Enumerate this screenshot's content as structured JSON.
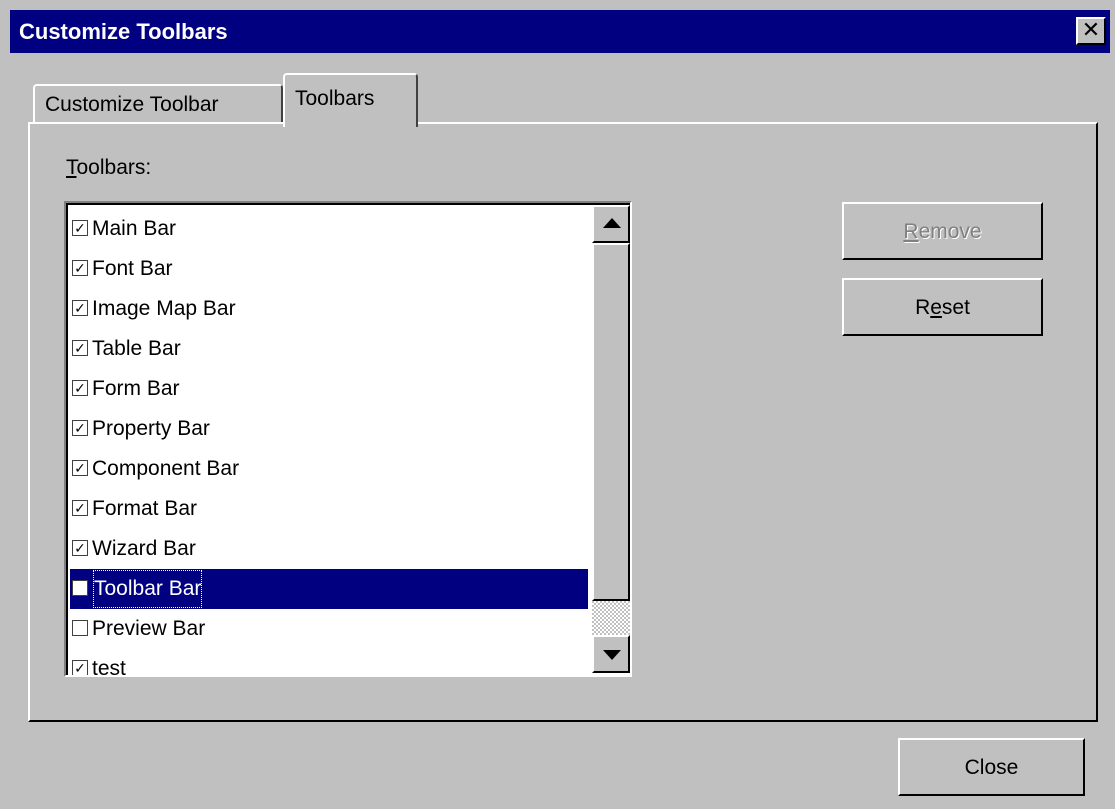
{
  "window": {
    "title": "Customize Toolbars",
    "close_glyph": "✕"
  },
  "tabs": [
    {
      "label": "Customize Toolbar",
      "active": false
    },
    {
      "label": "Toolbars",
      "active": true
    }
  ],
  "toolbars_label": {
    "accel": "T",
    "rest": "oolbars:"
  },
  "list": {
    "items": [
      {
        "label": "Main Bar",
        "checked": true,
        "selected": false
      },
      {
        "label": "Font Bar",
        "checked": true,
        "selected": false
      },
      {
        "label": "Image Map Bar",
        "checked": true,
        "selected": false
      },
      {
        "label": "Table Bar",
        "checked": true,
        "selected": false
      },
      {
        "label": "Form Bar",
        "checked": true,
        "selected": false
      },
      {
        "label": "Property Bar",
        "checked": true,
        "selected": false
      },
      {
        "label": "Component Bar",
        "checked": true,
        "selected": false
      },
      {
        "label": "Format Bar",
        "checked": true,
        "selected": false
      },
      {
        "label": "Wizard Bar",
        "checked": true,
        "selected": false
      },
      {
        "label": "Toolbar Bar",
        "checked": false,
        "selected": true
      },
      {
        "label": "Preview Bar",
        "checked": false,
        "selected": false
      },
      {
        "label": "test",
        "checked": true,
        "selected": false
      }
    ],
    "check_glyph": "✓"
  },
  "buttons": {
    "remove": {
      "accel": "R",
      "rest": "emove",
      "enabled": false
    },
    "reset": {
      "pre": "R",
      "accel": "e",
      "rest": "set",
      "enabled": true
    },
    "close": {
      "label": "Close"
    }
  },
  "colors": {
    "face": "#c0c0c0",
    "titlebar": "#000080",
    "selection": "#000080"
  }
}
